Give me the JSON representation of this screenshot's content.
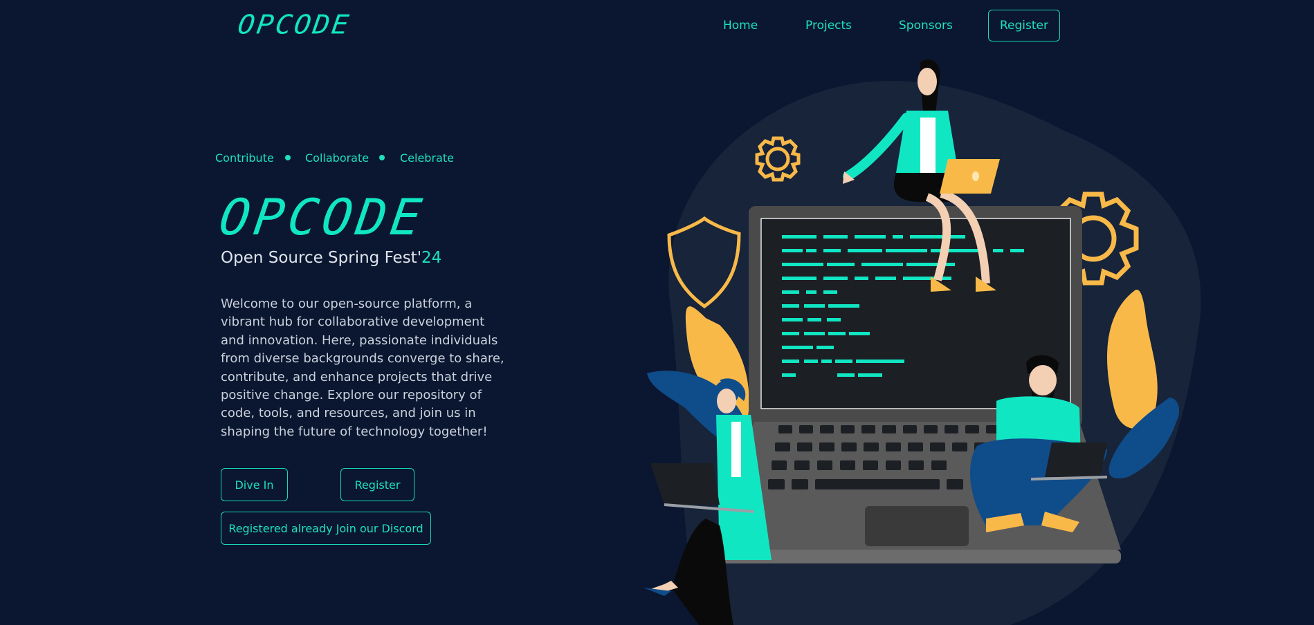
{
  "header": {
    "logo": "OPCODE",
    "nav": [
      "Home",
      "Projects",
      "Sponsors"
    ],
    "register_label": "Register"
  },
  "hero": {
    "tagline": [
      "Contribute",
      "Collaborate",
      "Celebrate"
    ],
    "logo": "OPCODE",
    "subtitle_main": "Open Source Spring Fest'",
    "subtitle_accent": "24",
    "description": "Welcome to our open-source platform, a vibrant hub for collaborative development and innovation. Here, passionate individuals from diverse backgrounds converge to share, contribute, and enhance projects that drive positive change. Explore our repository of code, tools, and resources, and join us in shaping the future of technology together!",
    "buttons": {
      "dive_in": "Dive In",
      "register": "Register",
      "discord": "Registered already Join our Discord"
    }
  },
  "colors": {
    "background": "#0b1730",
    "accent": "#11e6c3",
    "illustration_yellow": "#f9b949",
    "illustration_blue": "#0f4c8a"
  },
  "icons": [
    "gear-icon",
    "shield-icon"
  ]
}
